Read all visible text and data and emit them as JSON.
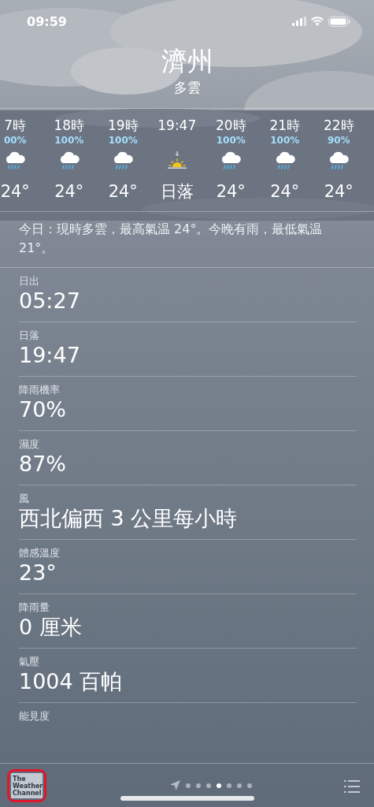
{
  "status_bar": {
    "time": "09:59"
  },
  "location": {
    "city": "濟州",
    "condition": "多雲"
  },
  "hourly": [
    {
      "kind": "rain",
      "time": "7時",
      "chance": "00%",
      "temp": "24°"
    },
    {
      "kind": "rain",
      "time": "18時",
      "chance": "100%",
      "temp": "24°"
    },
    {
      "kind": "rain",
      "time": "19時",
      "chance": "100%",
      "temp": "24°"
    },
    {
      "kind": "sunset",
      "time": "19:47",
      "temp": "日落"
    },
    {
      "kind": "rain",
      "time": "20時",
      "chance": "100%",
      "temp": "24°"
    },
    {
      "kind": "rain",
      "time": "21時",
      "chance": "100%",
      "temp": "24°"
    },
    {
      "kind": "rain",
      "time": "22時",
      "chance": "90%",
      "temp": "24°"
    }
  ],
  "summary": "今日：現時多雲，最高氣温 24°。今晚有雨，最低氣温 21°。",
  "details": [
    {
      "label": "日出",
      "value": "05:27"
    },
    {
      "label": "日落",
      "value": "19:47"
    },
    {
      "label": "降雨機率",
      "value": "70%"
    },
    {
      "label": "濕度",
      "value": "87%"
    },
    {
      "label": "風",
      "value": "西北偏西 3 公里每小時"
    },
    {
      "label": "體感溫度",
      "value": "23°"
    },
    {
      "label": "降雨量",
      "value": "0 厘米"
    },
    {
      "label": "氣壓",
      "value": "1004 百帕"
    },
    {
      "label": "能見度"
    }
  ],
  "footer": {
    "logo": [
      "The",
      "Weather",
      "Channel"
    ],
    "logo_highlighted": true,
    "page_dots": [
      {
        "selected": false
      },
      {
        "selected": false
      },
      {
        "selected": false
      },
      {
        "selected": true
      },
      {
        "selected": false
      },
      {
        "selected": false
      },
      {
        "selected": false
      }
    ]
  }
}
